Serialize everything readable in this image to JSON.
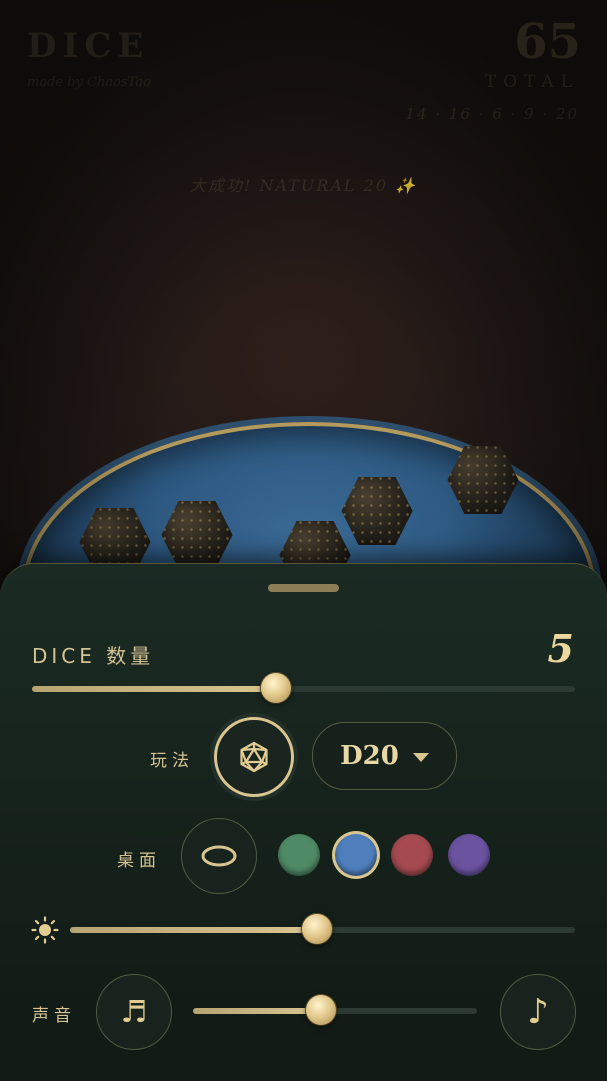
{
  "header": {
    "app_title": "DICE",
    "made_by": "made by ChaosTao",
    "total_value": "65",
    "total_label": "TOTAL",
    "roll_breakdown": "14 · 16 · 6 · 9 · 20",
    "critical_message": "大成功! NATURAL 20 ✨"
  },
  "panel": {
    "dice_count_label": "DICE 数量",
    "dice_count_value": "5",
    "dice_count_fraction": 0.45,
    "mode_label": "玩法",
    "mode_icon": "d20-icon",
    "dice_type": "D20",
    "table_label": "桌面",
    "tray_shape_icon": "oval-tray-icon",
    "tray_colors": [
      {
        "name": "green",
        "color": "#4f8a66",
        "selected": false
      },
      {
        "name": "blue",
        "color": "#4f7fbd",
        "selected": true
      },
      {
        "name": "red",
        "color": "#a44a50",
        "selected": false
      },
      {
        "name": "purple",
        "color": "#6b53a0",
        "selected": false
      }
    ],
    "brightness_icon": "sun-icon",
    "brightness_fraction": 0.49,
    "sound_label": "声音",
    "music_icon": "music-note-icon",
    "sound_volume_fraction": 0.45,
    "sfx_icon": "single-note-icon"
  },
  "colors": {
    "accent_gold": "#d9c58f",
    "panel_bg": "#142019",
    "tray_felt": "#2b567e"
  }
}
